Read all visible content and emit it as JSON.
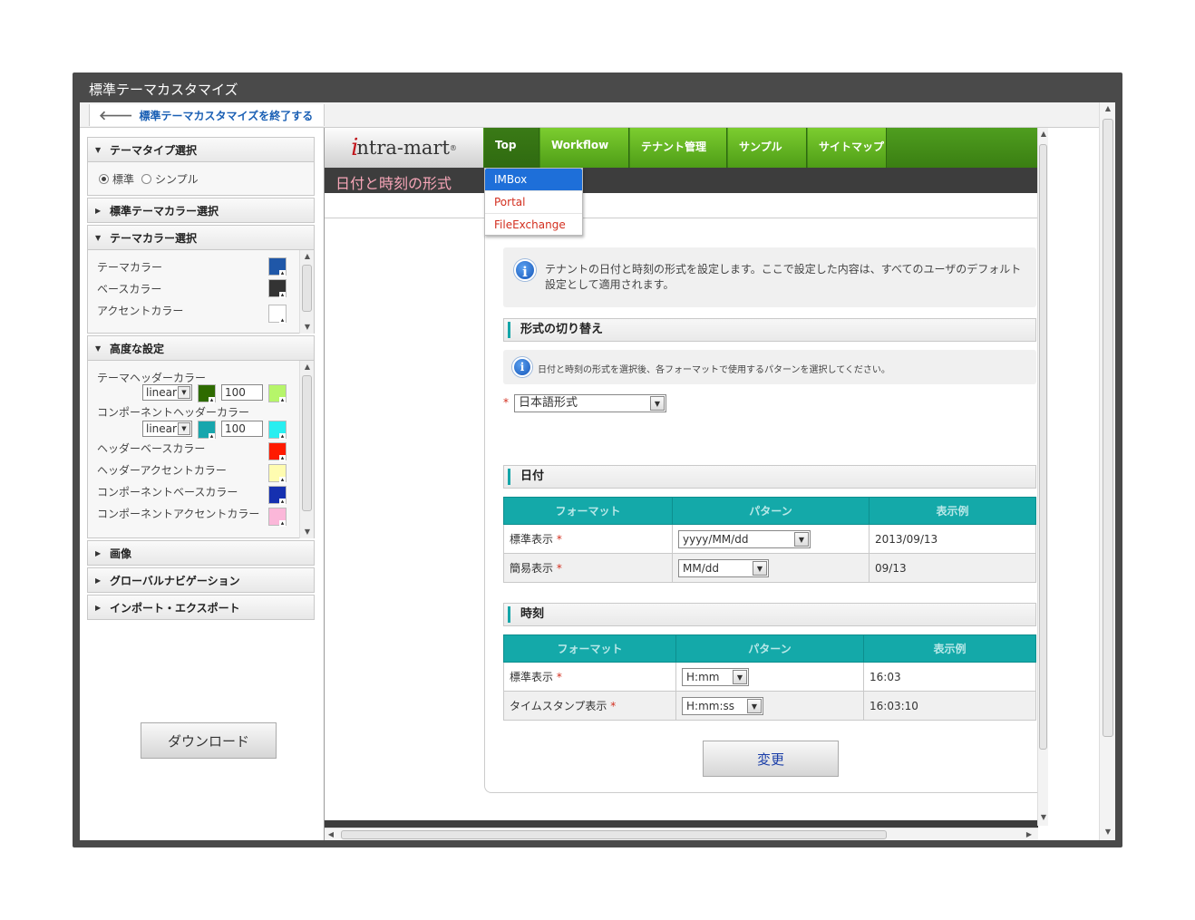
{
  "window": {
    "title": "標準テーマカスタマイズ"
  },
  "exit_link": {
    "label": "標準テーマカスタマイズを終了する"
  },
  "left_panel": {
    "theme_type": {
      "header": "テーマタイプ選択",
      "options": [
        "標準",
        "シンプル"
      ],
      "selected": "標準"
    },
    "std_color_header": "標準テーマカラー選択",
    "theme_color": {
      "header": "テーマカラー選択",
      "items": [
        {
          "label": "テーマカラー",
          "color": "#1f57a8"
        },
        {
          "label": "ベースカラー",
          "color": "#333333"
        },
        {
          "label": "アクセントカラー",
          "color": "#ffffff"
        }
      ]
    },
    "advanced": {
      "header": "高度な設定",
      "theme_header_color": {
        "label": "テーマヘッダーカラー",
        "mode": "linear",
        "color1": "#2e6b00",
        "value": "100",
        "color2": "#b6f56a"
      },
      "component_header_color": {
        "label": "コンポーネントヘッダーカラー",
        "mode": "linear",
        "color1": "#18a6ad",
        "value": "100",
        "color2": "#29eef0"
      },
      "items": [
        {
          "label": "ヘッダーベースカラー",
          "color": "#ff1a00"
        },
        {
          "label": "ヘッダーアクセントカラー",
          "color": "#fffcb0"
        },
        {
          "label": "コンポーネントベースカラー",
          "color": "#1530b0"
        },
        {
          "label": "コンポーネントアクセントカラー",
          "color": "#fbb7d9"
        }
      ]
    },
    "image_header": "画像",
    "global_nav_header": "グローバルナビゲーション",
    "import_export_header": "インポート・エクスポート",
    "download_label": "ダウンロード"
  },
  "preview": {
    "logo": {
      "i": "i",
      "rest": "ntra-mart",
      "mark": "®"
    },
    "nav_tabs": [
      "Top",
      "Workflow",
      "テナント管理",
      "サンプル",
      "サイトマップ"
    ],
    "active_tab": "Top",
    "dropdown_items": [
      "IMBox",
      "Portal",
      "FileExchange"
    ],
    "page_title": "日付と時刻の形式",
    "info_text": "テナントの日付と時刻の形式を設定します。ここで設定した内容は、すべてのユーザのデフォルト設定として適用されます。",
    "switch_section": "形式の切り替え",
    "switch_info": "日付と時刻の形式を選択後、各フォーマットで使用するパターンを選択してください。",
    "format_select": "日本語形式",
    "date_section": "日付",
    "time_section": "時刻",
    "table_headers": [
      "フォーマット",
      "パターン",
      "表示例"
    ],
    "date_rows": [
      {
        "format": "標準表示",
        "pattern": "yyyy/MM/dd",
        "example": "2013/09/13"
      },
      {
        "format": "簡易表示",
        "pattern": "MM/dd",
        "example": "09/13"
      }
    ],
    "time_rows": [
      {
        "format": "標準表示",
        "pattern": "H:mm",
        "example": "16:03"
      },
      {
        "format": "タイムスタンプ表示",
        "pattern": "H:mm:ss",
        "example": "16:03:10"
      }
    ],
    "change_label": "変更",
    "required_mark": "*"
  }
}
